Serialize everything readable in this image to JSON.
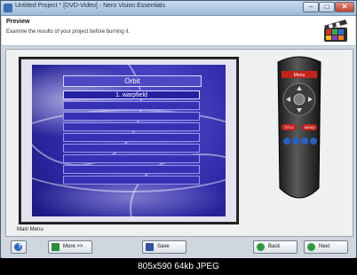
{
  "window": {
    "title": "Untitled Project * [DVD-Video] - Nero Vision Essentials",
    "min_glyph": "–",
    "max_glyph": "□",
    "close_glyph": "✕"
  },
  "header": {
    "title": "Preview",
    "subtitle": "Examine the results of your project before burning it."
  },
  "menu": {
    "title": "Orbit",
    "items": [
      "1. warpfield",
      "",
      "",
      "",
      "",
      "",
      "",
      "",
      ""
    ]
  },
  "remote": {
    "menu_label": "Menu",
    "title_btn": "TITLE",
    "menu_btn": "MENU"
  },
  "preview_label": "Main Menu",
  "toolbar": {
    "help_label": "?",
    "more_label": "More >>",
    "save_label": "Save",
    "back_label": "Back",
    "next_label": "Next"
  },
  "caption": "805x590  64kb  JPEG",
  "colors": {
    "menu_bg": "#3631b4",
    "screen_bg": "#2e2aa8",
    "remote_red": "#c4241c"
  }
}
